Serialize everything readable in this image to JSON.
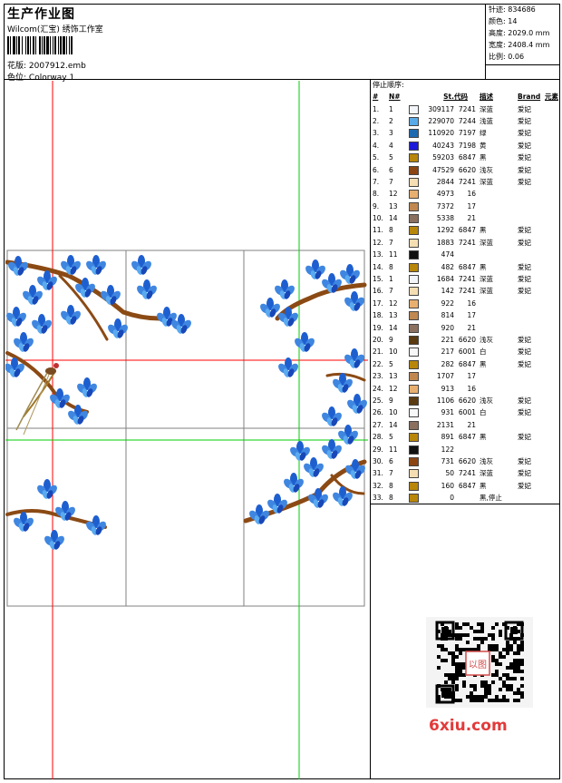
{
  "header": {
    "title": "生产作业图",
    "subtitle": "Wilcom(汇宝) 绣饰工作室",
    "design_label": "花版:",
    "design_value": "2007912.emb",
    "colorway_label": "色位:",
    "colorway_value": "Colorway 1"
  },
  "stats": {
    "stitches": "针迹: 834686",
    "colors": "颜色: 14",
    "height": "高度: 2029.0 mm",
    "width": "宽度: 2408.4 mm",
    "scale": "比例: 0.06"
  },
  "sequence": {
    "title": "停止顺序:",
    "columns": [
      "#",
      "N#",
      "",
      "St.",
      "代码",
      "描述",
      "Brand",
      "元素"
    ],
    "rows": [
      {
        "no": "1.",
        "n": "1",
        "color": "#f2f6fa",
        "st": "309117",
        "code": "7241",
        "desc": "深蓝",
        "brand": "爱妃"
      },
      {
        "no": "2.",
        "n": "2",
        "color": "#5aaae8",
        "st": "229070",
        "code": "7244",
        "desc": "浅蓝",
        "brand": "爱妃"
      },
      {
        "no": "3.",
        "n": "3",
        "color": "#1e6ab0",
        "st": "110920",
        "code": "7197",
        "desc": "绿",
        "brand": "爱妃"
      },
      {
        "no": "4.",
        "n": "4",
        "color": "#1a1ad8",
        "st": "40243",
        "code": "7198",
        "desc": "黄",
        "brand": "爱妃"
      },
      {
        "no": "5.",
        "n": "5",
        "color": "#b8860b",
        "st": "59203",
        "code": "6847",
        "desc": "黑",
        "brand": "爱妃"
      },
      {
        "no": "6.",
        "n": "6",
        "color": "#8b4513",
        "st": "47529",
        "code": "6620",
        "desc": "浅灰",
        "brand": "爱妃"
      },
      {
        "no": "7.",
        "n": "7",
        "color": "#f5deb3",
        "st": "2844",
        "code": "7241",
        "desc": "深蓝",
        "brand": "爱妃"
      },
      {
        "no": "8.",
        "n": "12",
        "color": "#e8b070",
        "st": "4973",
        "code": "16",
        "desc": "",
        "brand": ""
      },
      {
        "no": "9.",
        "n": "13",
        "color": "#c08850",
        "st": "7372",
        "code": "17",
        "desc": "",
        "brand": ""
      },
      {
        "no": "10.",
        "n": "14",
        "color": "#8b7060",
        "st": "5338",
        "code": "21",
        "desc": "",
        "brand": ""
      },
      {
        "no": "11.",
        "n": "8",
        "color": "#b8860b",
        "st": "1292",
        "code": "6847",
        "desc": "黑",
        "brand": "爱妃"
      },
      {
        "no": "12.",
        "n": "7",
        "color": "#f5deb3",
        "st": "1883",
        "code": "7241",
        "desc": "深蓝",
        "brand": "爱妃"
      },
      {
        "no": "13.",
        "n": "11",
        "color": "#111111",
        "st": "474",
        "code": "",
        "desc": "",
        "brand": ""
      },
      {
        "no": "14.",
        "n": "8",
        "color": "#b8860b",
        "st": "482",
        "code": "6847",
        "desc": "黑",
        "brand": "爱妃"
      },
      {
        "no": "15.",
        "n": "1",
        "color": "#f2f6fa",
        "st": "1684",
        "code": "7241",
        "desc": "深蓝",
        "brand": "爱妃"
      },
      {
        "no": "16.",
        "n": "7",
        "color": "#f5deb3",
        "st": "142",
        "code": "7241",
        "desc": "深蓝",
        "brand": "爱妃"
      },
      {
        "no": "17.",
        "n": "12",
        "color": "#e8b070",
        "st": "922",
        "code": "16",
        "desc": "",
        "brand": ""
      },
      {
        "no": "18.",
        "n": "13",
        "color": "#c08850",
        "st": "814",
        "code": "17",
        "desc": "",
        "brand": ""
      },
      {
        "no": "19.",
        "n": "14",
        "color": "#8b7060",
        "st": "920",
        "code": "21",
        "desc": "",
        "brand": ""
      },
      {
        "no": "20.",
        "n": "9",
        "color": "#5a3a10",
        "st": "221",
        "code": "6620",
        "desc": "浅灰",
        "brand": "爱妃"
      },
      {
        "no": "21.",
        "n": "10",
        "color": "#f8f8f8",
        "st": "217",
        "code": "6001",
        "desc": "白",
        "brand": "爱妃"
      },
      {
        "no": "22.",
        "n": "5",
        "color": "#b8860b",
        "st": "282",
        "code": "6847",
        "desc": "黑",
        "brand": "爱妃"
      },
      {
        "no": "23.",
        "n": "13",
        "color": "#c08850",
        "st": "1707",
        "code": "17",
        "desc": "",
        "brand": ""
      },
      {
        "no": "24.",
        "n": "12",
        "color": "#e8b070",
        "st": "913",
        "code": "16",
        "desc": "",
        "brand": ""
      },
      {
        "no": "25.",
        "n": "9",
        "color": "#5a3a10",
        "st": "1106",
        "code": "6620",
        "desc": "浅灰",
        "brand": "爱妃"
      },
      {
        "no": "26.",
        "n": "10",
        "color": "#f8f8f8",
        "st": "931",
        "code": "6001",
        "desc": "白",
        "brand": "爱妃"
      },
      {
        "no": "27.",
        "n": "14",
        "color": "#8b7060",
        "st": "2131",
        "code": "21",
        "desc": "",
        "brand": ""
      },
      {
        "no": "28.",
        "n": "5",
        "color": "#b8860b",
        "st": "891",
        "code": "6847",
        "desc": "黑",
        "brand": "爱妃"
      },
      {
        "no": "29.",
        "n": "11",
        "color": "#111111",
        "st": "122",
        "code": "",
        "desc": "",
        "brand": ""
      },
      {
        "no": "30.",
        "n": "6",
        "color": "#8b4513",
        "st": "731",
        "code": "6620",
        "desc": "浅灰",
        "brand": "爱妃"
      },
      {
        "no": "31.",
        "n": "7",
        "color": "#f5deb3",
        "st": "50",
        "code": "7241",
        "desc": "深蓝",
        "brand": "爱妃"
      },
      {
        "no": "32.",
        "n": "8",
        "color": "#b8860b",
        "st": "160",
        "code": "6847",
        "desc": "黑",
        "brand": "爱妃"
      },
      {
        "no": "33.",
        "n": "8",
        "color": "#b8860b",
        "st": "0",
        "code": "",
        "desc": "黑,停止",
        "brand": ""
      }
    ]
  },
  "watermark": {
    "site": "6xiu.com",
    "qr_badge": "以图"
  },
  "colors": {
    "guide_red": "#ff0000",
    "guide_green": "#00cc00",
    "flower_blue": "#1e5fd0",
    "flower_light": "#5aaaf0",
    "branch_brown": "#8b4a14"
  }
}
